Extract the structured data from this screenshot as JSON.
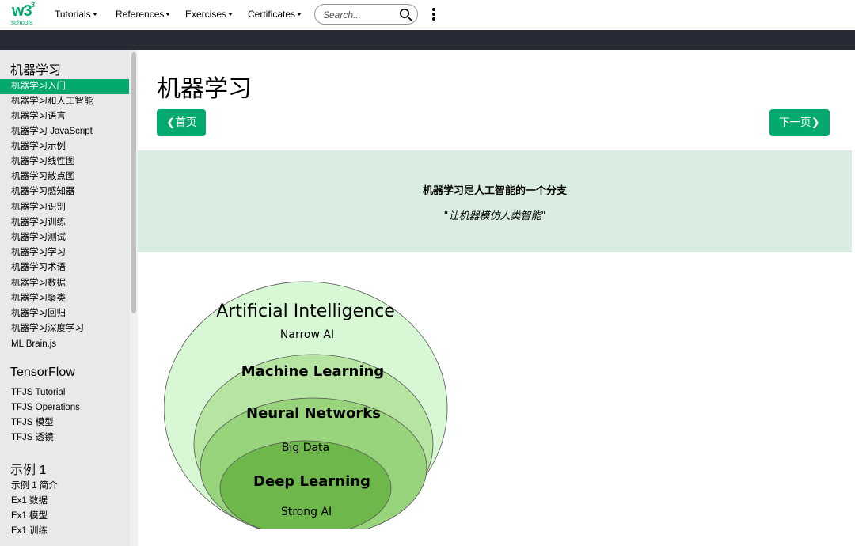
{
  "logo": {
    "mark": "w3",
    "superscript": "3",
    "word": "schools"
  },
  "nav": {
    "items": [
      "Tutorials",
      "References",
      "Exercises",
      "Certificates"
    ],
    "search_placeholder": "Search...",
    "search_icon": "search-icon",
    "more_icon": "kebab-menu-icon"
  },
  "sidebar": {
    "sections": [
      {
        "heading": "机器学习",
        "items": [
          "机器学习入门",
          "机器学习和人工智能",
          "机器学习语言",
          "机器学习 JavaScript",
          "机器学习示例",
          "机器学习线性图",
          "机器学习散点图",
          "机器学习感知器",
          "机器学习识别",
          "机器学习训练",
          "机器学习测试",
          "机器学习学习",
          "机器学习术语",
          "机器学习数据",
          "机器学习聚类",
          "机器学习回归",
          "机器学习深度学习",
          "ML Brain.js"
        ]
      },
      {
        "heading": "TensorFlow",
        "items": [
          "TFJS Tutorial",
          "TFJS Operations",
          "TFJS 模型",
          "TFJS 透镜"
        ]
      },
      {
        "heading": "示例 1",
        "items": [
          "示例 1 简介",
          "Ex1 数据",
          "Ex1 模型",
          "Ex1 训练"
        ]
      }
    ],
    "active_item": "机器学习入门"
  },
  "main": {
    "title": "机器学习",
    "prev_button": "首页",
    "next_button": "下一页",
    "banner": {
      "part1": "机器学习",
      "part2": "是",
      "part3": "人工智能的一个分支",
      "quote": "\"让机器模仿人类智能\""
    },
    "diagram": {
      "outer_title": "Artificial Intelligence",
      "outer_sub": "Narrow AI",
      "ml": "Machine Learning",
      "nn": "Neural Networks",
      "big_data": "Big Data",
      "dl": "Deep Learning",
      "strong_ai": "Strong AI",
      "colors": [
        "#D8F8D5",
        "#B5E5A1",
        "#98D47C",
        "#6EB84B"
      ]
    }
  },
  "colors": {
    "accent": "#04AA6D",
    "dark_bar": "#282A35",
    "sidebar_bg": "#E7E9EB",
    "banner_bg": "#D9EEE1"
  }
}
